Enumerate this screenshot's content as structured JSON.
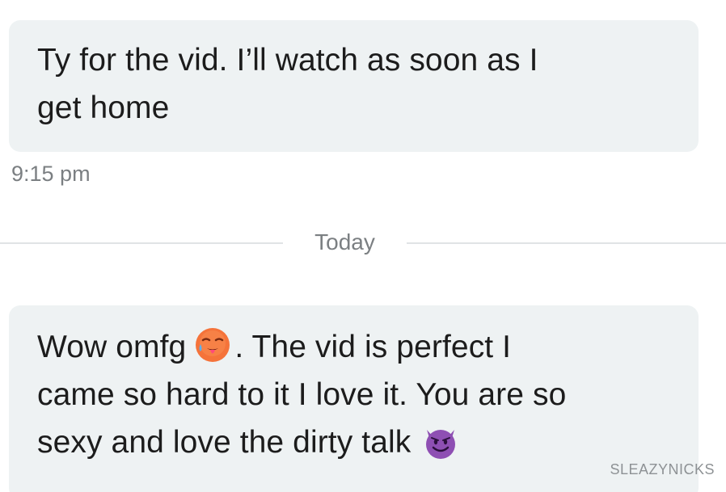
{
  "messages": [
    {
      "lines": [
        "Ty for the vid. I’ll watch as soon as I",
        "get home"
      ],
      "time": "9:15 pm"
    },
    {
      "line1_before": "Wow omfg",
      "line1_emoji": "hot-face-emoji",
      "line1_after": ". The vid is perfect I",
      "line2": "came so hard to it I love it. You are so",
      "line3": "sexy and love the dirty talk",
      "line3_emoji": "smiling-devil-emoji"
    }
  ],
  "divider": {
    "label": "Today"
  },
  "watermark": "SLEAZYNICKS",
  "colors": {
    "bubble_background": "#eef2f3",
    "text": "#1c1c1c",
    "meta_text": "#7b7f82",
    "divider": "#e0e3e5",
    "hot_face": "#f5733a",
    "devil": "#8e4fb3"
  }
}
